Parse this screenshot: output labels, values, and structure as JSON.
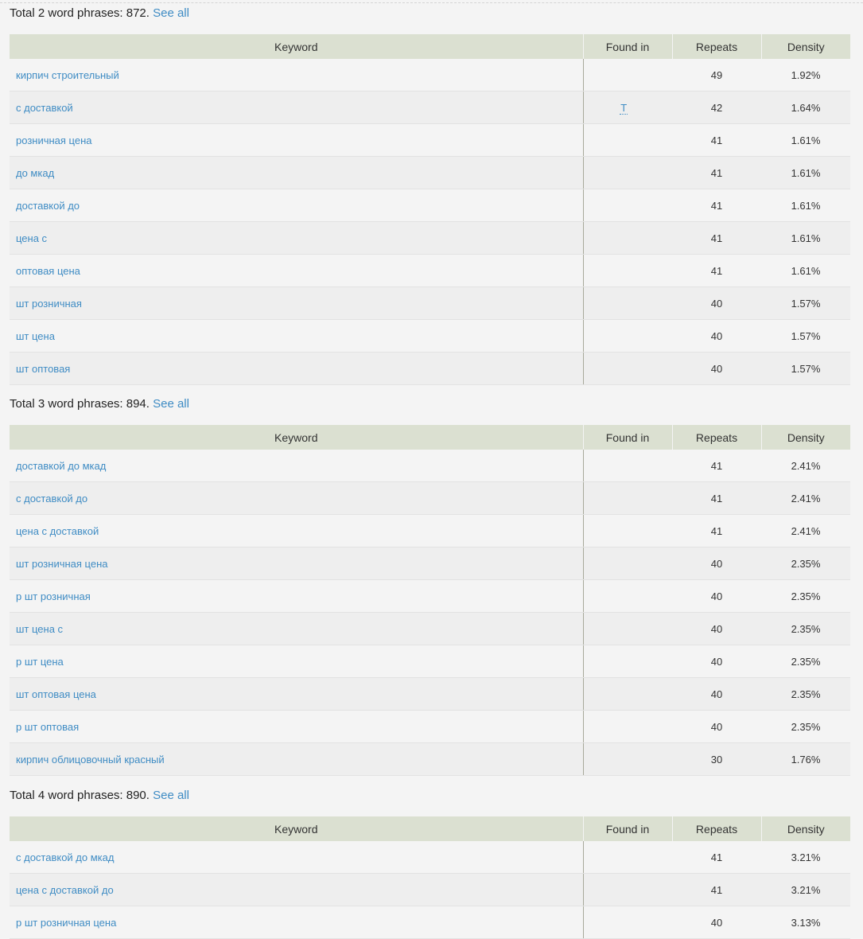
{
  "table_headers": {
    "keyword": "Keyword",
    "found_in": "Found in",
    "repeats": "Repeats",
    "density": "Density"
  },
  "see_all_label": "See all",
  "sections": [
    {
      "title_prefix": "Total 2 word phrases: 872.",
      "rows": [
        {
          "keyword": "кирпич строительный",
          "found_in": "",
          "repeats": "49",
          "density": "1.92%"
        },
        {
          "keyword": "с доставкой",
          "found_in": "T",
          "repeats": "42",
          "density": "1.64%"
        },
        {
          "keyword": "розничная цена",
          "found_in": "",
          "repeats": "41",
          "density": "1.61%"
        },
        {
          "keyword": "до мкад",
          "found_in": "",
          "repeats": "41",
          "density": "1.61%"
        },
        {
          "keyword": "доставкой до",
          "found_in": "",
          "repeats": "41",
          "density": "1.61%"
        },
        {
          "keyword": "цена с",
          "found_in": "",
          "repeats": "41",
          "density": "1.61%"
        },
        {
          "keyword": "оптовая цена",
          "found_in": "",
          "repeats": "41",
          "density": "1.61%"
        },
        {
          "keyword": "шт розничная",
          "found_in": "",
          "repeats": "40",
          "density": "1.57%"
        },
        {
          "keyword": "шт цена",
          "found_in": "",
          "repeats": "40",
          "density": "1.57%"
        },
        {
          "keyword": "шт оптовая",
          "found_in": "",
          "repeats": "40",
          "density": "1.57%"
        }
      ]
    },
    {
      "title_prefix": "Total 3 word phrases: 894.",
      "rows": [
        {
          "keyword": "доставкой до мкад",
          "found_in": "",
          "repeats": "41",
          "density": "2.41%"
        },
        {
          "keyword": "с доставкой до",
          "found_in": "",
          "repeats": "41",
          "density": "2.41%"
        },
        {
          "keyword": "цена с доставкой",
          "found_in": "",
          "repeats": "41",
          "density": "2.41%"
        },
        {
          "keyword": "шт розничная цена",
          "found_in": "",
          "repeats": "40",
          "density": "2.35%"
        },
        {
          "keyword": "р шт розничная",
          "found_in": "",
          "repeats": "40",
          "density": "2.35%"
        },
        {
          "keyword": "шт цена с",
          "found_in": "",
          "repeats": "40",
          "density": "2.35%"
        },
        {
          "keyword": "р шт цена",
          "found_in": "",
          "repeats": "40",
          "density": "2.35%"
        },
        {
          "keyword": "шт оптовая цена",
          "found_in": "",
          "repeats": "40",
          "density": "2.35%"
        },
        {
          "keyword": "р шт оптовая",
          "found_in": "",
          "repeats": "40",
          "density": "2.35%"
        },
        {
          "keyword": "кирпич облицовочный красный",
          "found_in": "",
          "repeats": "30",
          "density": "1.76%"
        }
      ]
    },
    {
      "title_prefix": "Total 4 word phrases: 890.",
      "rows": [
        {
          "keyword": "с доставкой до мкад",
          "found_in": "",
          "repeats": "41",
          "density": "3.21%"
        },
        {
          "keyword": "цена с доставкой до",
          "found_in": "",
          "repeats": "41",
          "density": "3.21%"
        },
        {
          "keyword": "р шт розничная цена",
          "found_in": "",
          "repeats": "40",
          "density": "3.13%"
        }
      ]
    }
  ]
}
